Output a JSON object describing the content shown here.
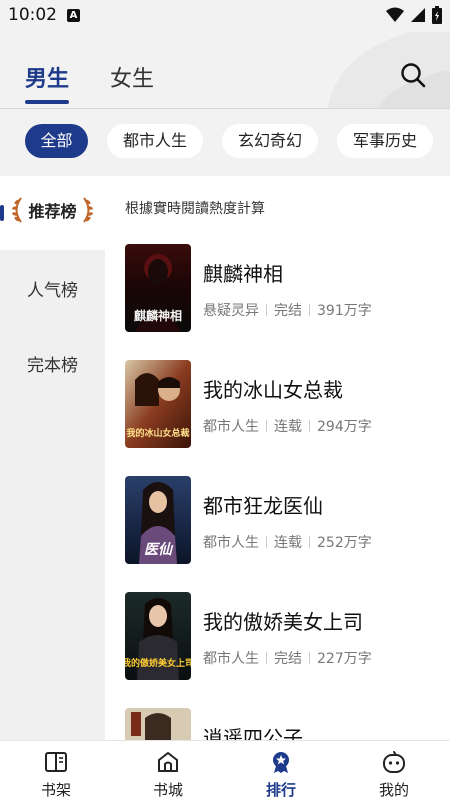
{
  "status_bar": {
    "time": "10:02",
    "notification_letter": "A"
  },
  "header": {
    "tabs": [
      {
        "label": "男生",
        "active": true
      },
      {
        "label": "女生",
        "active": false
      }
    ]
  },
  "categories": [
    {
      "label": "全部",
      "active": true
    },
    {
      "label": "都市人生",
      "active": false
    },
    {
      "label": "玄幻奇幻",
      "active": false
    },
    {
      "label": "军事历史",
      "active": false
    }
  ],
  "sidebar": {
    "items": [
      {
        "label": "推荐榜",
        "active": true
      },
      {
        "label": "人气榜",
        "active": false
      },
      {
        "label": "完本榜",
        "active": false
      }
    ]
  },
  "main": {
    "note": "根據實時閱讀熱度計算",
    "books": [
      {
        "title": "麒麟神相",
        "genre": "悬疑灵异",
        "status": "完结",
        "words": "391万字",
        "cover_text": "麒麟神相"
      },
      {
        "title": "我的冰山女总裁",
        "genre": "都市人生",
        "status": "连载",
        "words": "294万字",
        "cover_text": "我的冰山女总裁"
      },
      {
        "title": "都市狂龙医仙",
        "genre": "都市人生",
        "status": "连载",
        "words": "252万字",
        "cover_text": "医仙"
      },
      {
        "title": "我的傲娇美女上司",
        "genre": "都市人生",
        "status": "完结",
        "words": "227万字",
        "cover_text": "我的傲娇美女上司"
      },
      {
        "title": "逍遥四公子",
        "genre": "",
        "status": "",
        "words": "",
        "cover_text": ""
      }
    ]
  },
  "bottom_nav": [
    {
      "label": "书架",
      "icon": "book-icon",
      "active": false
    },
    {
      "label": "书城",
      "icon": "store-icon",
      "active": false
    },
    {
      "label": "排行",
      "icon": "rank-icon",
      "active": true
    },
    {
      "label": "我的",
      "icon": "profile-icon",
      "active": false
    }
  ],
  "colors": {
    "accent": "#1e3a8a",
    "laurel": "#c0662a"
  }
}
